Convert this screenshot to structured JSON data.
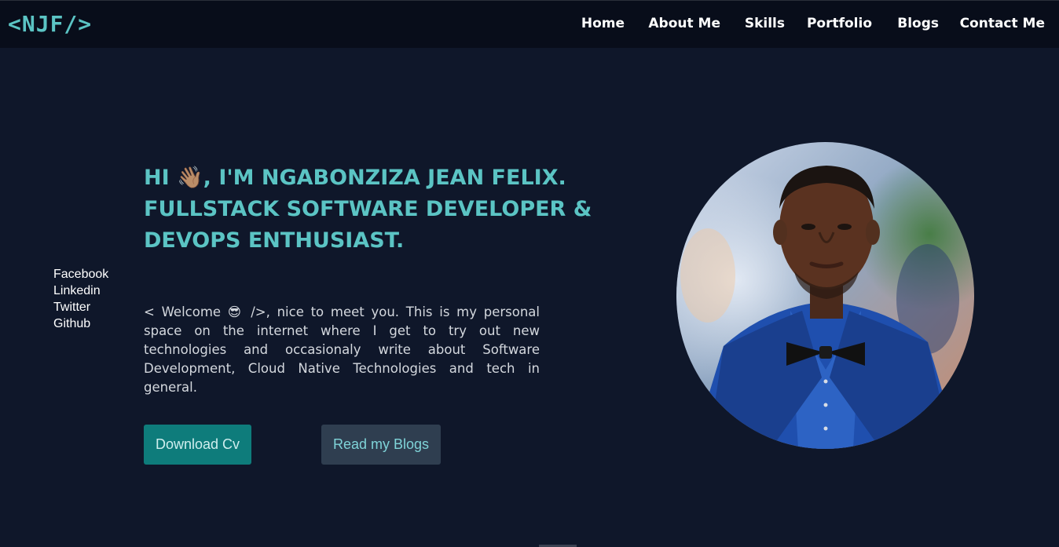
{
  "nav": {
    "logo": "<NJF/>",
    "links": [
      "Home",
      "About Me",
      "Skills",
      "Portfolio",
      "Blogs",
      "Contact Me"
    ]
  },
  "social": [
    "Facebook",
    "Linkedin",
    "Twitter",
    "Github"
  ],
  "hero": {
    "headline_lines": [
      "HI 👋🏽, I'M NGABONZIZA JEAN FELIX.",
      "FULLSTACK SOFTWARE DEVELOPER &",
      "DEVOPS ENTHUSIAST."
    ],
    "intro": "< Welcome 😎 />, nice to meet you. This is my personal space on the internet where I get to try out new technologies and occasionaly write about Software Development, Cloud Native Technologies and tech in general.",
    "buttons": {
      "download_cv": "Download Cv",
      "read_blogs": "Read my Blogs"
    }
  },
  "colors": {
    "accent": "#5bc4c4",
    "background": "#0f172a",
    "navbar": "#080d1a",
    "cv_button": "#0e7c7b",
    "blog_button": "#2f3e50"
  }
}
